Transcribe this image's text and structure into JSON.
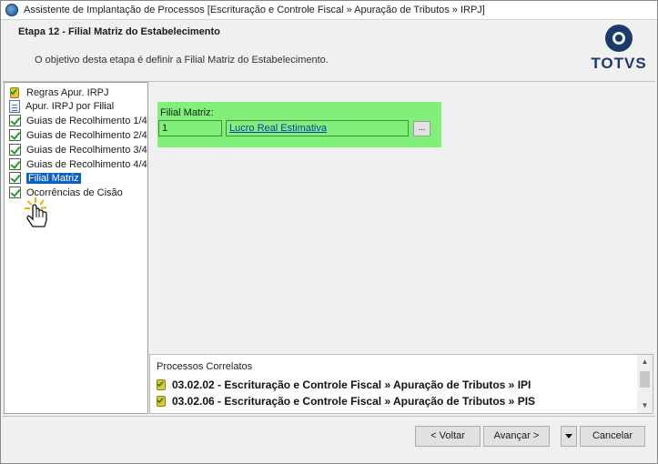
{
  "window": {
    "title": "Assistente de Implantação de Processos [Escrituração e Controle Fiscal » Apuração de Tributos » IRPJ]"
  },
  "header": {
    "step_title": "Etapa 12 - Filial Matriz do Estabelecimento",
    "description": "O objetivo desta etapa é definir a Filial Matriz do Estabelecimento.",
    "logo_text": "TOTVS"
  },
  "tree": {
    "items": [
      {
        "label": "Regras Apur. IRPJ",
        "icon": "badge-check-icon"
      },
      {
        "label": "Apur. IRPJ por Filial",
        "icon": "document-icon"
      },
      {
        "label": "Guias de Recolhimento 1/4",
        "icon": "checkbox-checked-icon"
      },
      {
        "label": "Guias de Recolhimento 2/4",
        "icon": "checkbox-checked-icon"
      },
      {
        "label": "Guias de Recolhimento 3/4",
        "icon": "checkbox-checked-icon"
      },
      {
        "label": "Guias de Recolhimento 4/4",
        "icon": "checkbox-checked-icon"
      },
      {
        "label": "Filial Matriz",
        "icon": "checkbox-checked-icon",
        "selected": true
      },
      {
        "label": "Ocorrências de Cisão",
        "icon": "checkbox-checked-icon"
      }
    ]
  },
  "form": {
    "field_label": "Filial Matriz:",
    "code_value": "1",
    "desc_value": "Lucro Real Estimativa",
    "lookup_label": "..."
  },
  "related": {
    "title": "Processos Correlatos",
    "rows": [
      "03.02.02 - Escrituração e Controle Fiscal » Apuração de Tributos » IPI",
      "03.02.06 - Escrituração e Controle Fiscal » Apuração de Tributos » PIS"
    ]
  },
  "buttons": {
    "back": "< Voltar",
    "next": "Avançar >",
    "cancel": "Cancelar"
  },
  "colors": {
    "highlight_panel": "#80f07a",
    "selection": "#0b62c4",
    "logo": "#1b3a6b"
  }
}
